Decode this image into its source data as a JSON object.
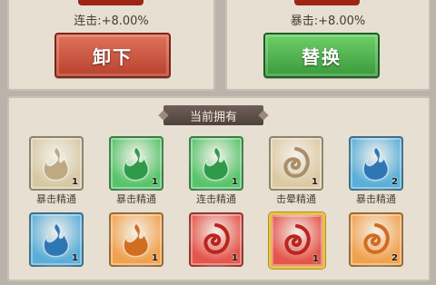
{
  "left_panel": {
    "stat": "连击:+8.00%",
    "button": "卸下"
  },
  "right_panel": {
    "stat": "暴击:+8.00%",
    "button": "替换"
  },
  "owned": {
    "title": "当前拥有",
    "items": [
      {
        "label": "暴击精通",
        "count": "1",
        "tile_color": "#d7c8a4",
        "flame": "#bfa983",
        "icon": "flame-icon",
        "selected": false
      },
      {
        "label": "暴击精通",
        "count": "1",
        "tile_color": "#58c46a",
        "flame": "#2f9a48",
        "icon": "flame-icon",
        "selected": false
      },
      {
        "label": "连击精通",
        "count": "1",
        "tile_color": "#58c46a",
        "flame": "#2f9a48",
        "icon": "flame-icon",
        "selected": false
      },
      {
        "label": "击晕精通",
        "count": "1",
        "tile_color": "#dcc9a2",
        "flame": "#a88e6b",
        "icon": "swirl-icon",
        "selected": false
      },
      {
        "label": "暴击精通",
        "count": "2",
        "tile_color": "#5aaed8",
        "flame": "#2f77b4",
        "icon": "flame-icon",
        "selected": false
      },
      {
        "label": "",
        "count": "1",
        "tile_color": "#5aaed8",
        "flame": "#2f77b4",
        "icon": "flame-icon",
        "selected": false
      },
      {
        "label": "",
        "count": "1",
        "tile_color": "#f0a24f",
        "flame": "#d16d20",
        "icon": "flame-icon",
        "selected": false
      },
      {
        "label": "",
        "count": "1",
        "tile_color": "#e4554b",
        "flame": "#b9251f",
        "icon": "swirl-icon",
        "selected": false
      },
      {
        "label": "",
        "count": "1",
        "tile_color": "#e4554b",
        "flame": "#b9251f",
        "icon": "swirl-icon",
        "selected": true
      },
      {
        "label": "",
        "count": "2",
        "tile_color": "#f0a24f",
        "flame": "#d16d20",
        "icon": "swirl-icon",
        "selected": false
      }
    ]
  }
}
